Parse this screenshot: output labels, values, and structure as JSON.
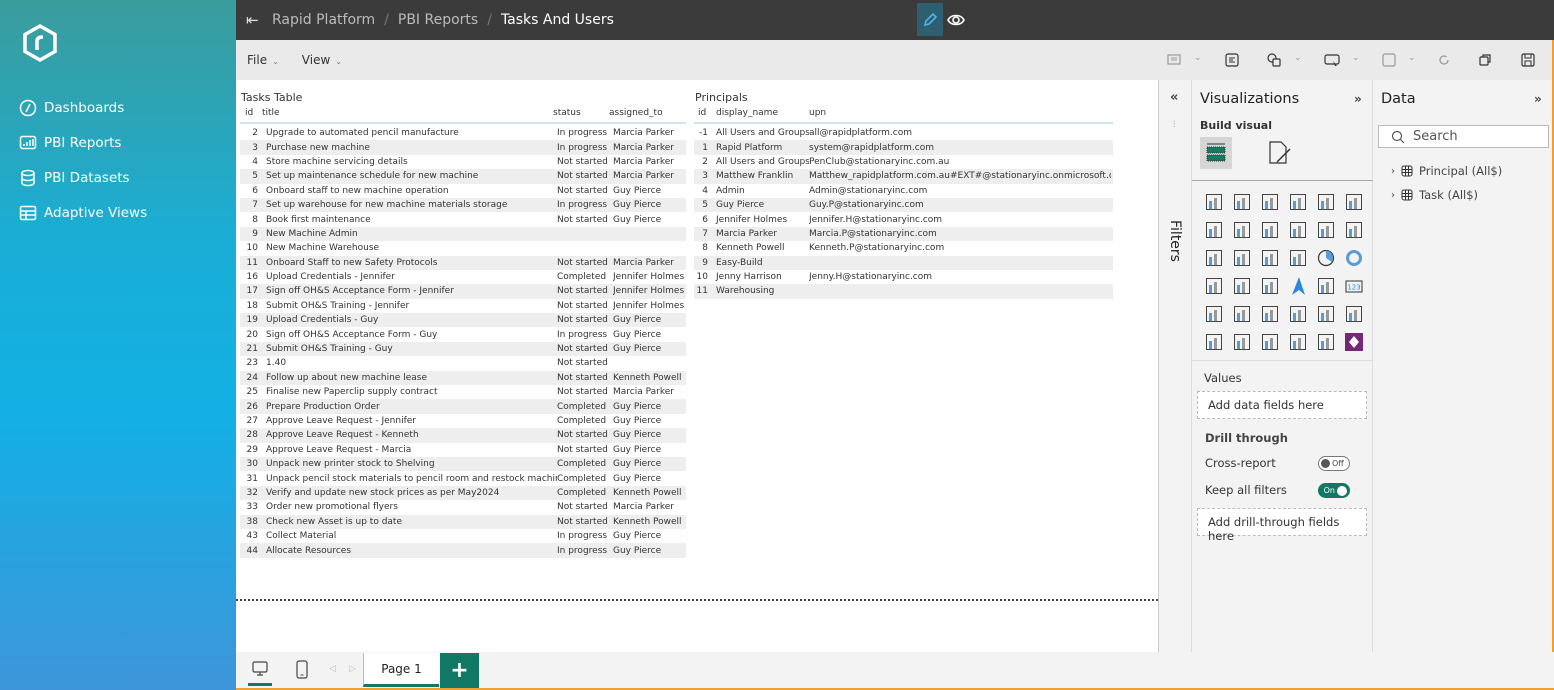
{
  "sidebar": {
    "items": [
      {
        "label": "Dashboards",
        "icon": "gauge-icon"
      },
      {
        "label": "PBI Reports",
        "icon": "report-icon"
      },
      {
        "label": "PBI Datasets",
        "icon": "database-icon"
      },
      {
        "label": "Adaptive Views",
        "icon": "table-icon"
      }
    ]
  },
  "header": {
    "breadcrumb": [
      "Rapid Platform",
      "PBI Reports",
      "Tasks And Users"
    ]
  },
  "menubar": {
    "file": "File",
    "view": "View"
  },
  "tasks": {
    "title": "Tasks Table",
    "columns": [
      "id",
      "title",
      "status",
      "assigned_to"
    ],
    "rows": [
      [
        "2",
        "Upgrade to automated pencil manufacture",
        "In progress",
        "Marcia Parker"
      ],
      [
        "3",
        "Purchase new machine",
        "In progress",
        "Marcia Parker"
      ],
      [
        "4",
        "Store machine servicing details",
        "Not started",
        "Marcia Parker"
      ],
      [
        "5",
        "Set up maintenance schedule for new machine",
        "Not started",
        "Marcia Parker"
      ],
      [
        "6",
        "Onboard staff to new machine operation",
        "Not started",
        "Guy Pierce"
      ],
      [
        "7",
        "Set up warehouse for new machine materials storage",
        "In progress",
        "Guy Pierce"
      ],
      [
        "8",
        "Book first maintenance",
        "Not started",
        "Guy Pierce"
      ],
      [
        "9",
        "New Machine Admin",
        "",
        ""
      ],
      [
        "10",
        "New Machine Warehouse",
        "",
        ""
      ],
      [
        "11",
        "Onboard Staff to new Safety Protocols",
        "Not started",
        "Marcia Parker"
      ],
      [
        "16",
        "Upload Credentials - Jennifer",
        "Completed",
        "Jennifer Holmes"
      ],
      [
        "17",
        "Sign off OH&S Acceptance Form - Jennifer",
        "Not started",
        "Jennifer Holmes"
      ],
      [
        "18",
        "Submit OH&S Training - Jennifer",
        "Not started",
        "Jennifer Holmes"
      ],
      [
        "19",
        "Upload Credentials - Guy",
        "Not started",
        "Guy Pierce"
      ],
      [
        "20",
        "Sign off OH&S Acceptance Form - Guy",
        "In progress",
        "Guy Pierce"
      ],
      [
        "21",
        "Submit OH&S Training - Guy",
        "Not started",
        "Guy Pierce"
      ],
      [
        "23",
        "1.40",
        "Not started",
        ""
      ],
      [
        "24",
        "Follow up about new machine lease",
        "Not started",
        "Kenneth Powell"
      ],
      [
        "25",
        "Finalise new Paperclip supply contract",
        "Not started",
        "Marcia Parker"
      ],
      [
        "26",
        "Prepare Production Order",
        "Completed",
        "Guy Pierce"
      ],
      [
        "27",
        "Approve Leave Request - Jennifer",
        "Completed",
        "Guy Pierce"
      ],
      [
        "28",
        "Approve Leave Request - Kenneth",
        "Not started",
        "Guy Pierce"
      ],
      [
        "29",
        "Approve Leave Request - Marcia",
        "Not started",
        "Guy Pierce"
      ],
      [
        "30",
        "Unpack new printer stock to Shelving",
        "Completed",
        "Guy Pierce"
      ],
      [
        "31",
        "Unpack pencil stock materials to pencil room and restock machines.",
        "Completed",
        "Guy Pierce"
      ],
      [
        "32",
        "Verify and update new stock prices as per May2024",
        "Completed",
        "Kenneth Powell"
      ],
      [
        "33",
        "Order new promotional flyers",
        "Not started",
        "Marcia Parker"
      ],
      [
        "38",
        "Check new Asset is up to date",
        "Not started",
        "Kenneth Powell"
      ],
      [
        "43",
        "Collect Material",
        "In progress",
        "Guy Pierce"
      ],
      [
        "44",
        "Allocate Resources",
        "In progress",
        "Guy Pierce"
      ]
    ]
  },
  "principals": {
    "title": "Principals",
    "columns": [
      "id",
      "display_name",
      "upn"
    ],
    "rows": [
      [
        "-1",
        "All Users and Groups",
        "all@rapidplatform.com"
      ],
      [
        "1",
        "Rapid Platform",
        "system@rapidplatform.com"
      ],
      [
        "2",
        "All Users and Groups",
        "PenClub@stationaryinc.com.au"
      ],
      [
        "3",
        "Matthew Franklin",
        "Matthew_rapidplatform.com.au#EXT#@stationaryinc.onmicrosoft.com"
      ],
      [
        "4",
        "Admin",
        "Admin@stationaryinc.com"
      ],
      [
        "5",
        "Guy Pierce",
        "Guy.P@stationaryinc.com"
      ],
      [
        "6",
        "Jennifer Holmes",
        "Jennifer.H@stationaryinc.com"
      ],
      [
        "7",
        "Marcia Parker",
        "Marcia.P@stationaryinc.com"
      ],
      [
        "8",
        "Kenneth Powell",
        "Kenneth.P@stationaryinc.com"
      ],
      [
        "9",
        "Easy-Build",
        ""
      ],
      [
        "10",
        "Jenny Harrison",
        "Jenny.H@stationaryinc.com"
      ],
      [
        "11",
        "Warehousing",
        ""
      ]
    ]
  },
  "filters": {
    "label": "Filters"
  },
  "viz": {
    "title": "Visualizations",
    "build_visual": "Build visual",
    "values_label": "Values",
    "values_placeholder": "Add data fields here",
    "drill_through": "Drill through",
    "cross_report": "Cross-report",
    "cross_report_state": "Off",
    "keep_filters": "Keep all filters",
    "keep_filters_state": "On",
    "drill_placeholder": "Add drill-through fields here",
    "icons": [
      "stacked-bar-icon",
      "stacked-column-icon",
      "clustered-bar-icon",
      "clustered-column-icon",
      "100-stacked-bar-icon",
      "100-stacked-column-icon",
      "line-chart-icon",
      "area-chart-icon",
      "stacked-area-icon",
      "100-stacked-area-icon",
      "line-clustered-column-icon",
      "line-stacked-column-icon",
      "ribbon-chart-icon",
      "waterfall-icon",
      "funnel-icon",
      "scatter-icon",
      "pie-icon",
      "donut-icon",
      "treemap-icon",
      "map-icon",
      "filled-map-icon",
      "azure-map-icon",
      "gauge-icon",
      "card-icon",
      "multi-row-card-icon",
      "kpi-icon",
      "slicer-icon",
      "table-icon",
      "matrix-icon",
      "key-influencers-icon",
      "decomposition-tree-icon",
      "qna-icon",
      "narrative-icon",
      "goals-icon",
      "paginated-report-icon",
      "power-apps-icon"
    ]
  },
  "data_pane": {
    "title": "Data",
    "search_placeholder": "Search",
    "tables": [
      "Principal (All$)",
      "Task (All$)"
    ]
  },
  "pages": {
    "tab": "Page 1",
    "add": "+"
  },
  "colors": {
    "accent": "#117865",
    "topbar": "#3b3b3b",
    "edit_active": "#2d5f70"
  }
}
